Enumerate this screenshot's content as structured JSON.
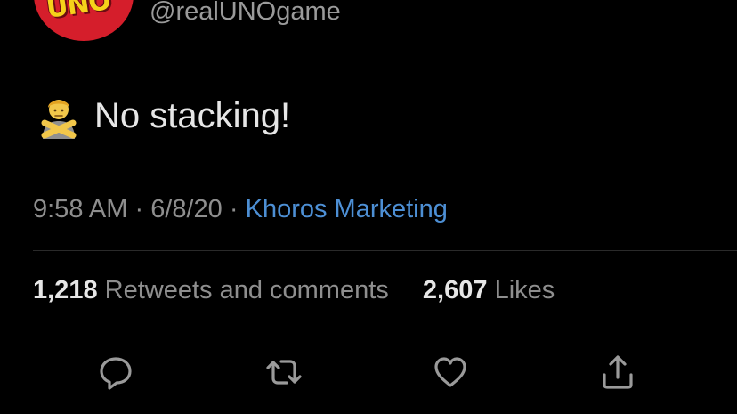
{
  "tweet": {
    "handle": "@realUNOgame",
    "text": "No stacking!",
    "emoji": "person-gesturing-no-emoji",
    "time": "9:58 AM",
    "separator": " · ",
    "date": "6/8/20",
    "source": "Khoros Marketing"
  },
  "stats": {
    "retweets_count": "1,218",
    "retweets_label": "Retweets and comments",
    "likes_count": "2,607",
    "likes_label": "Likes"
  },
  "actions": [
    {
      "icon": "reply-icon"
    },
    {
      "icon": "retweet-icon"
    },
    {
      "icon": "like-icon"
    },
    {
      "icon": "share-icon"
    }
  ],
  "colors": {
    "background": "#000000",
    "text": "#e6e6e6",
    "muted": "#8e8e8e",
    "link": "#4d8fd4",
    "avatar": "#d51e2b"
  }
}
